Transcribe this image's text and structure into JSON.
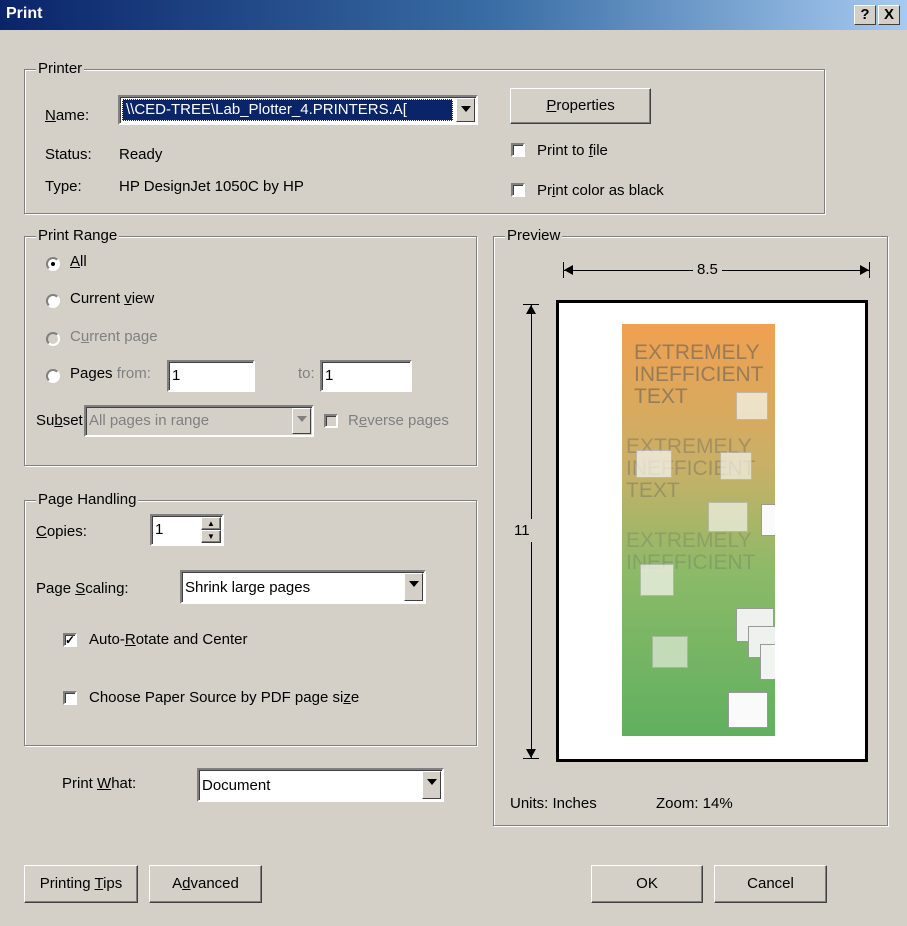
{
  "window": {
    "title": "Print",
    "help_glyph": "?",
    "close_glyph": "X"
  },
  "printer": {
    "legend": "Printer",
    "name_label": "Name:",
    "name_value": "\\\\CED-TREE\\Lab_Plotter_4.PRINTERS.A[",
    "status_label": "Status:",
    "status_value": "Ready",
    "type_label": "Type:",
    "type_value": "HP DesignJet 1050C by HP",
    "properties_label": "Properties",
    "print_to_file_label": "Print to file",
    "print_color_as_black_label": "Print color as black"
  },
  "print_range": {
    "legend": "Print Range",
    "all_label": "All",
    "current_view_label": "Current view",
    "current_page_label": "Current page",
    "pages_label": "Pages",
    "from_label": "from:",
    "from_value": "1",
    "to_label": "to:",
    "to_value": "1",
    "subset_label": "Subset:",
    "subset_value": "All pages in range",
    "reverse_pages_label": "Reverse pages"
  },
  "page_handling": {
    "legend": "Page Handling",
    "copies_label": "Copies:",
    "copies_value": "1",
    "scaling_label": "Page Scaling:",
    "scaling_value": "Shrink large pages",
    "auto_rotate_label": "Auto-Rotate and Center",
    "auto_rotate_checked": true,
    "paper_source_label": "Choose Paper Source by PDF page size"
  },
  "print_what": {
    "label": "Print What:",
    "value": "Document"
  },
  "preview": {
    "legend": "Preview",
    "width_label": "8.5",
    "height_label": "11",
    "units_label": "Units: Inches",
    "zoom_label": "Zoom: 14%",
    "poster_lines": [
      "EXTREMELY",
      "INEFFICIENT",
      "TEXT"
    ]
  },
  "buttons": {
    "printing_tips": "Printing Tips",
    "advanced": "Advanced",
    "ok": "OK",
    "cancel": "Cancel"
  },
  "colors": {
    "title_start": "#0a246a",
    "title_end": "#a6caf0",
    "dialog_bg": "#d4d0c8",
    "poster_top": "#f0a050",
    "poster_bottom": "#60b060"
  }
}
